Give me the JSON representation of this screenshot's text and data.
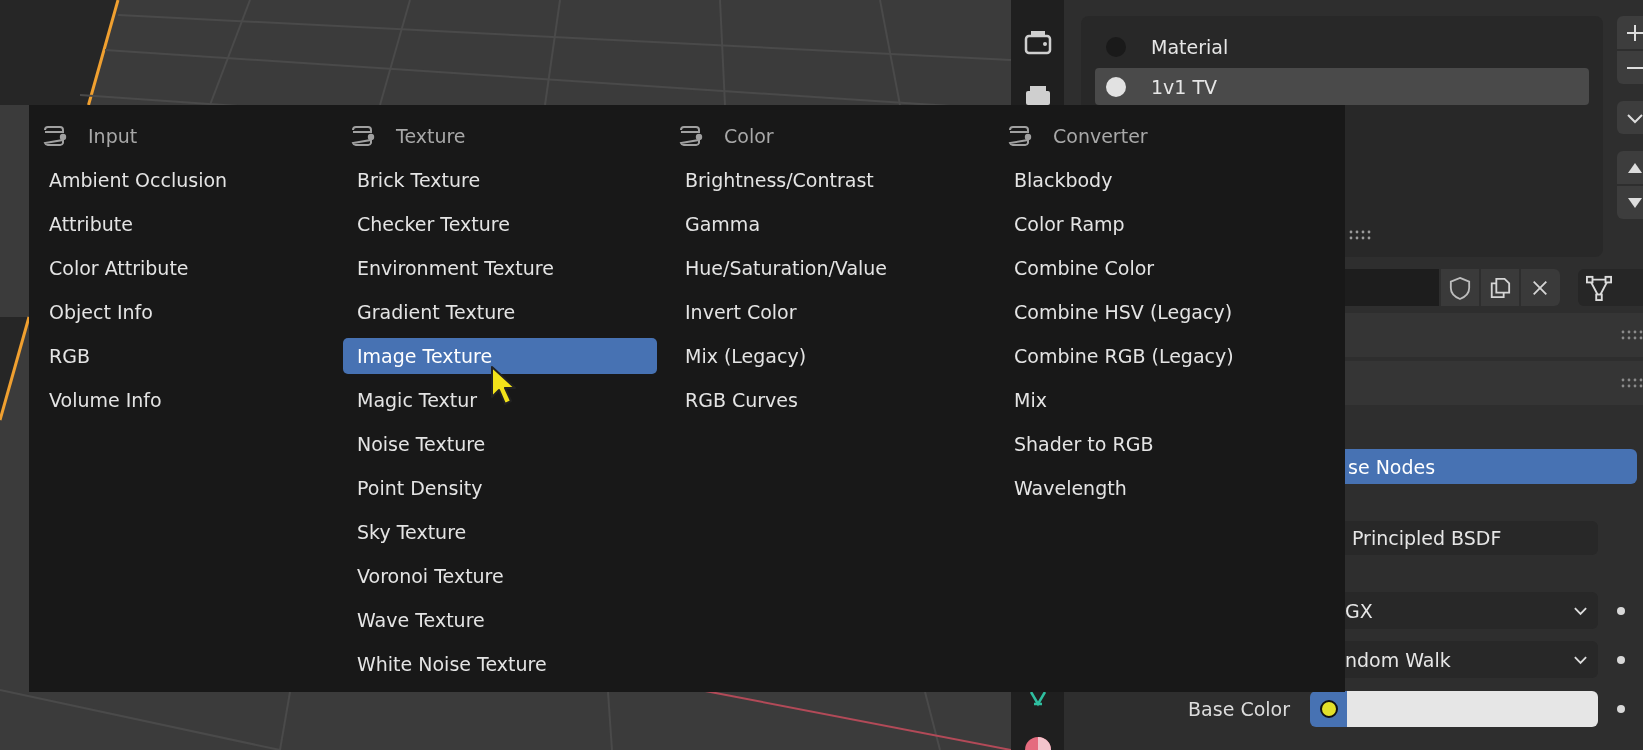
{
  "properties": {
    "material_slots": [
      {
        "name": "Material",
        "color": "#1a1a1a",
        "selected": false
      },
      {
        "name": "1v1 TV",
        "color": "#e2e2e2",
        "selected": true
      }
    ],
    "use_nodes": {
      "label": "se Nodes"
    },
    "surface": "Principled BSDF",
    "distribution": "GX",
    "subsurface_method": "ndom Walk",
    "base_color": {
      "label": "Base Color"
    }
  },
  "add_menu": {
    "columns": [
      {
        "title": "Input",
        "items": [
          {
            "label": "Ambient Occlusion",
            "selected": false
          },
          {
            "label": "Attribute",
            "selected": false
          },
          {
            "label": "Color Attribute",
            "selected": false
          },
          {
            "label": "Object Info",
            "selected": false
          },
          {
            "label": "RGB",
            "selected": false
          },
          {
            "label": "Volume Info",
            "selected": false
          }
        ]
      },
      {
        "title": "Texture",
        "items": [
          {
            "label": "Brick Texture",
            "selected": false
          },
          {
            "label": "Checker Texture",
            "selected": false
          },
          {
            "label": "Environment Texture",
            "selected": false
          },
          {
            "label": "Gradient Texture",
            "selected": false
          },
          {
            "label": "Image Texture",
            "selected": true
          },
          {
            "label": "Magic Textur",
            "selected": false
          },
          {
            "label": "Noise Texture",
            "selected": false
          },
          {
            "label": "Point Density",
            "selected": false
          },
          {
            "label": "Sky Texture",
            "selected": false
          },
          {
            "label": "Voronoi Texture",
            "selected": false
          },
          {
            "label": "Wave Texture",
            "selected": false
          },
          {
            "label": "White Noise Texture",
            "selected": false
          }
        ]
      },
      {
        "title": "Color",
        "items": [
          {
            "label": "Brightness/Contrast",
            "selected": false
          },
          {
            "label": "Gamma",
            "selected": false
          },
          {
            "label": "Hue/Saturation/Value",
            "selected": false
          },
          {
            "label": "Invert Color",
            "selected": false
          },
          {
            "label": "Mix (Legacy)",
            "selected": false
          },
          {
            "label": "RGB Curves",
            "selected": false
          }
        ]
      },
      {
        "title": "Converter",
        "items": [
          {
            "label": "Blackbody",
            "selected": false
          },
          {
            "label": "Color Ramp",
            "selected": false
          },
          {
            "label": "Combine Color",
            "selected": false
          },
          {
            "label": "Combine HSV (Legacy)",
            "selected": false
          },
          {
            "label": "Combine RGB (Legacy)",
            "selected": false
          },
          {
            "label": "Mix",
            "selected": false
          },
          {
            "label": "Shader to RGB",
            "selected": false
          },
          {
            "label": "Wavelength",
            "selected": false
          }
        ]
      }
    ]
  }
}
